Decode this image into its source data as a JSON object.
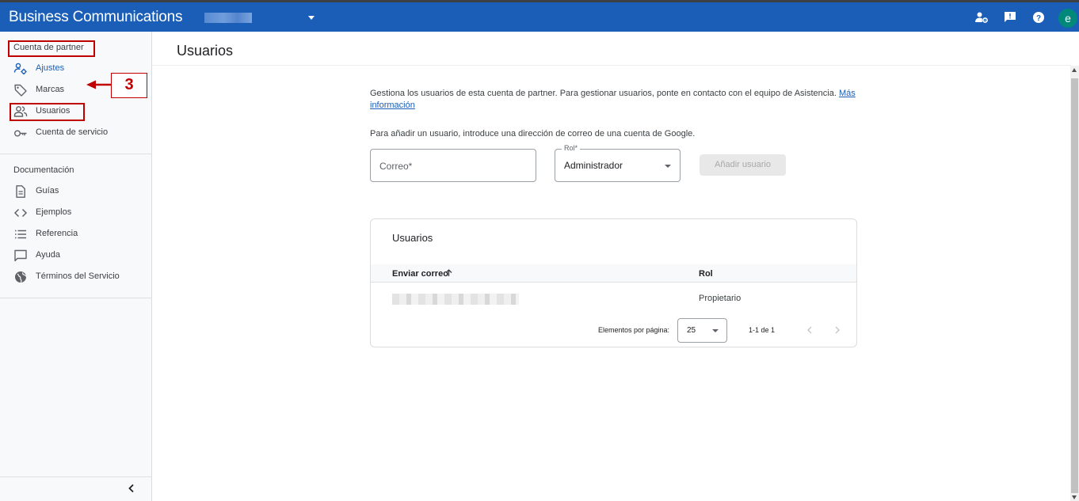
{
  "app": {
    "title": "Business Communications",
    "avatar_letter": "e"
  },
  "topbar_icons": [
    "manage-accounts-icon",
    "feedback-icon",
    "help-icon"
  ],
  "sidebar": {
    "section_partner": "Cuenta de partner",
    "partner_items": [
      {
        "label": "Ajustes",
        "icon": "settings-account-icon",
        "active": true
      },
      {
        "label": "Marcas",
        "icon": "tag-icon"
      },
      {
        "label": "Usuarios",
        "icon": "users-icon"
      },
      {
        "label": "Cuenta de servicio",
        "icon": "key-icon"
      }
    ],
    "section_docs": "Documentación",
    "doc_items": [
      {
        "label": "Guías",
        "icon": "document-icon"
      },
      {
        "label": "Ejemplos",
        "icon": "code-icon"
      },
      {
        "label": "Referencia",
        "icon": "list-icon"
      },
      {
        "label": "Ayuda",
        "icon": "chat-icon"
      },
      {
        "label": "Términos del Servicio",
        "icon": "globe-icon"
      }
    ]
  },
  "annotation": {
    "step_number": "3",
    "color": "#c00000"
  },
  "page": {
    "title": "Usuarios",
    "description": "Gestiona los usuarios de esta cuenta de partner. Para gestionar usuarios, ponte en contacto con el equipo de Asistencia.",
    "more_info_link": "Más información",
    "add_instruction": "Para añadir un usuario, introduce una dirección de correo de una cuenta de Google.",
    "email_placeholder": "Correo*",
    "role_label": "Rol*",
    "role_value": "Administrador",
    "add_button": "Añadir usuario"
  },
  "users_table": {
    "title": "Usuarios",
    "columns": [
      "Enviar correo",
      "Rol"
    ],
    "rows": [
      {
        "email": "",
        "role": "Propietario"
      }
    ],
    "items_per_page_label": "Elementos por página:",
    "items_per_page": "25",
    "range": "1-1 de 1"
  },
  "colors": {
    "brand_blue": "#1a5eb8",
    "avatar_teal": "#00897b"
  }
}
